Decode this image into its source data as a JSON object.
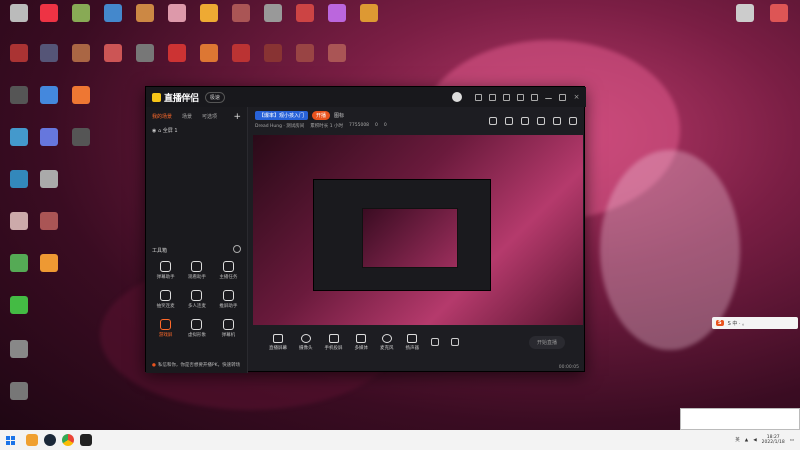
{
  "app": {
    "logo": "直播伴侣",
    "version_pill": "极速",
    "tabs": [
      "我的场景",
      "场景",
      "可选项"
    ],
    "scene_item": "全屏 1",
    "toolbox_label": "工具箱",
    "tools": [
      {
        "label": "弹幕助手",
        "icon": "danmaku-icon"
      },
      {
        "label": "观看助手",
        "icon": "viewer-icon"
      },
      {
        "label": "主播任务",
        "icon": "task-icon"
      },
      {
        "label": "抽奖连麦",
        "icon": "lottery-icon"
      },
      {
        "label": "多人连麦",
        "icon": "multi-link-icon"
      },
      {
        "label": "推屏助手",
        "icon": "push-icon"
      },
      {
        "label": "游戏屏",
        "icon": "game-screen-icon",
        "highlight": true
      },
      {
        "label": "虚拟形象",
        "icon": "avatar-icon"
      },
      {
        "label": "弹幕机",
        "icon": "danmaku-machine-icon"
      }
    ],
    "game_tag": "【爆率】观小孩入门",
    "status_tag": "开播",
    "sub_tag": "图标",
    "info_line": [
      "Dread Hung · 测试房间",
      "累积时长 1 小时",
      "7755008",
      "0",
      "0"
    ],
    "bottom_tools": [
      "直播屏幕",
      "摄像头",
      "手机投屏",
      "多媒体",
      "麦克风",
      "扬声器"
    ],
    "start_label": "开始直播",
    "notice": "私信和你，你是否想要开播PK，快速转场",
    "timer": "00:00:05"
  },
  "taskbar": {
    "time": "18:27",
    "date": "2022/1/18",
    "lang": "英"
  },
  "ime": {
    "label": "S 中 · 。"
  }
}
